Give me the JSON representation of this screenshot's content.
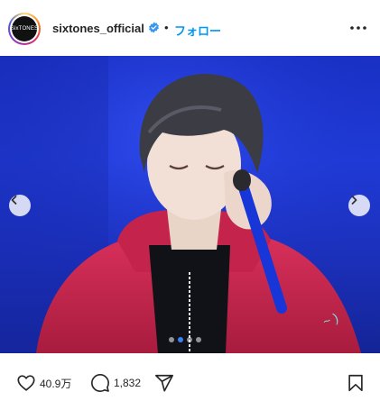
{
  "header": {
    "avatar_text": "SixTONES",
    "username": "sixtones_official",
    "separator": "•",
    "follow_label": "フォロー",
    "more_icon": "more-horizontal-icon"
  },
  "media": {
    "carousel_index": 1,
    "carousel_total": 4,
    "prev_icon": "chevron-left-icon",
    "next_icon": "chevron-right-icon"
  },
  "actions": {
    "like_count": "40.9万",
    "comment_count": "1,832",
    "icons": [
      "heart-icon",
      "comment-icon",
      "share-icon",
      "bookmark-icon"
    ]
  },
  "colors": {
    "follow_blue": "#0095f6",
    "verified_blue": "#3897f0",
    "stage_blue": "#1f3ad6",
    "hoodie_red": "#c8234a"
  }
}
